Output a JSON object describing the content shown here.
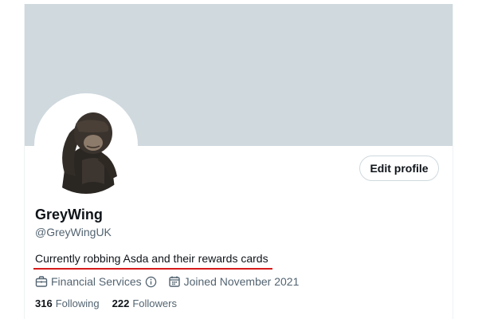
{
  "profile": {
    "display_name": "GreyWing",
    "handle": "@GreyWingUK",
    "bio": "Currently robbing Asda and their rewards cards",
    "category": "Financial Services",
    "joined": "Joined November 2021",
    "edit_button_label": "Edit profile",
    "following_count": "316",
    "following_label": "Following",
    "followers_count": "222",
    "followers_label": "Followers"
  },
  "colors": {
    "banner": "#cfd9de",
    "primary_text": "#0f1419",
    "secondary_text": "#536471",
    "annotation_underline": "#d61a1a"
  },
  "icons": {
    "category": "briefcase-icon",
    "info": "info-icon",
    "joined": "calendar-icon"
  }
}
